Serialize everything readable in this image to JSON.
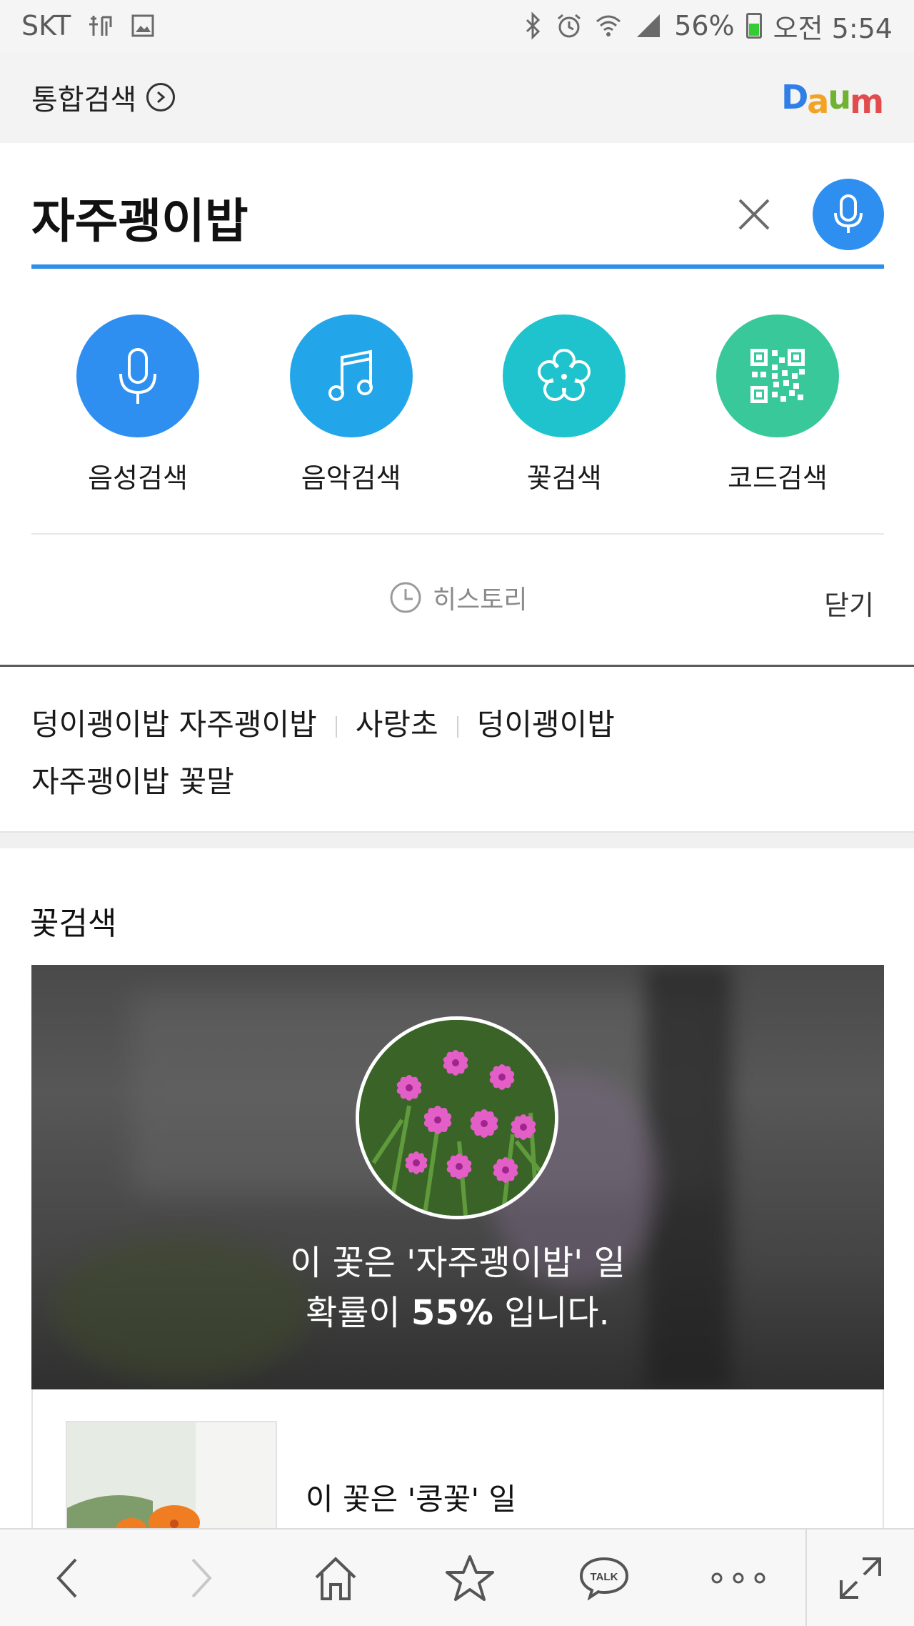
{
  "status_bar": {
    "carrier": "SKT",
    "battery_percent": "56%",
    "time": "오전 5:54",
    "battery_level": 0.56
  },
  "header": {
    "integrated_search_label": "통합검색",
    "logo_text": "Daum",
    "logo_colors": [
      "#2f7fe6",
      "#f2a324",
      "#70b232",
      "#e24c4c"
    ]
  },
  "search": {
    "query": "자주괭이밥",
    "accent_color": "#2f8ee8"
  },
  "tools": [
    {
      "label": "음성검색",
      "icon": "mic-icon",
      "color": "#2e8ff0"
    },
    {
      "label": "음악검색",
      "icon": "music-note-icon",
      "color": "#23a6e9"
    },
    {
      "label": "꽃검색",
      "icon": "flower-icon",
      "color": "#1ec3cd"
    },
    {
      "label": "코드검색",
      "icon": "qr-code-icon",
      "color": "#38c89a"
    }
  ],
  "history": {
    "label": "히스토리",
    "close_label": "닫기"
  },
  "related_searches": [
    "덩이괭이밥 자주괭이밥",
    "사랑초",
    "덩이괭이밥",
    "자주괭이밥 꽃말"
  ],
  "flower_search": {
    "section_title": "꽃검색",
    "top_result": {
      "line1": "이 꽃은 '자주괭이밥' 일",
      "prefix": "확률이 ",
      "percent": "55%",
      "suffix": " 입니다."
    },
    "second_result": {
      "line1": "이 꽃은 '콩꽃' 일"
    }
  },
  "toolbar": {
    "talk_label": "TALK"
  }
}
